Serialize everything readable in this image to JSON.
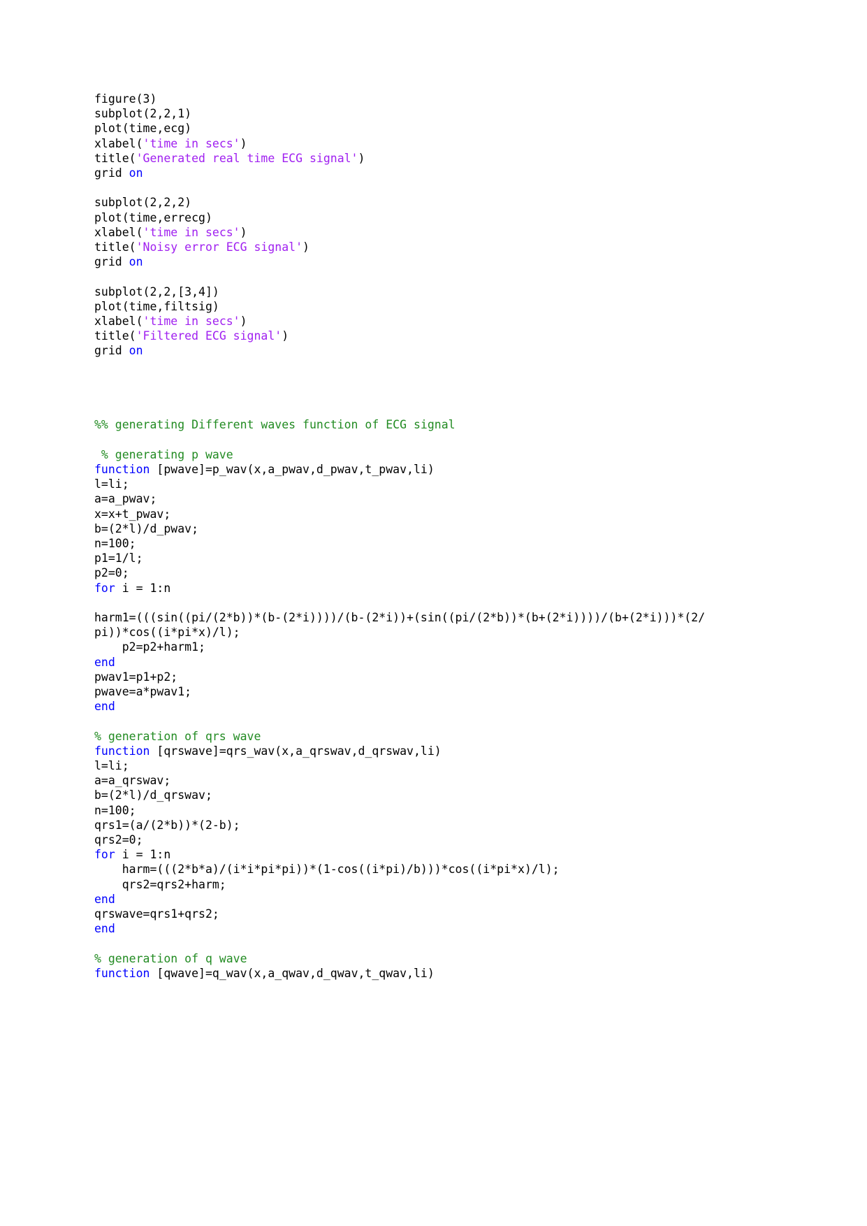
{
  "document": {
    "kind": "source-code-listing",
    "language": "MATLAB",
    "page_background": "#ffffff",
    "colors": {
      "plain": "#000000",
      "string": "#a020f0",
      "comment": "#228b22",
      "keyword": "#0000ff"
    }
  },
  "code": {
    "lines": [
      {
        "id": "l1",
        "type": "code",
        "tokens": [
          {
            "t": "figure(3)",
            "c": "plain"
          }
        ]
      },
      {
        "id": "l2",
        "type": "code",
        "tokens": [
          {
            "t": "subplot(2,2,1)",
            "c": "plain"
          }
        ]
      },
      {
        "id": "l3",
        "type": "code",
        "tokens": [
          {
            "t": "plot(time,ecg)",
            "c": "plain"
          }
        ]
      },
      {
        "id": "l4",
        "type": "code",
        "tokens": [
          {
            "t": "xlabel(",
            "c": "plain"
          },
          {
            "t": "'time in secs'",
            "c": "string"
          },
          {
            "t": ")",
            "c": "plain"
          }
        ]
      },
      {
        "id": "l5",
        "type": "code",
        "tokens": [
          {
            "t": "title(",
            "c": "plain"
          },
          {
            "t": "'Generated real time ECG signal'",
            "c": "string"
          },
          {
            "t": ")",
            "c": "plain"
          }
        ]
      },
      {
        "id": "l6",
        "type": "code",
        "tokens": [
          {
            "t": "grid ",
            "c": "plain"
          },
          {
            "t": "on",
            "c": "keyword"
          }
        ]
      },
      {
        "id": "l7",
        "type": "blank",
        "tokens": []
      },
      {
        "id": "l8",
        "type": "code",
        "tokens": [
          {
            "t": "subplot(2,2,2)",
            "c": "plain"
          }
        ]
      },
      {
        "id": "l9",
        "type": "code",
        "tokens": [
          {
            "t": "plot(time,errecg)",
            "c": "plain"
          }
        ]
      },
      {
        "id": "l10",
        "type": "code",
        "tokens": [
          {
            "t": "xlabel(",
            "c": "plain"
          },
          {
            "t": "'time in secs'",
            "c": "string"
          },
          {
            "t": ")",
            "c": "plain"
          }
        ]
      },
      {
        "id": "l11",
        "type": "code",
        "tokens": [
          {
            "t": "title(",
            "c": "plain"
          },
          {
            "t": "'Noisy error ECG signal'",
            "c": "string"
          },
          {
            "t": ")",
            "c": "plain"
          }
        ]
      },
      {
        "id": "l12",
        "type": "code",
        "tokens": [
          {
            "t": "grid ",
            "c": "plain"
          },
          {
            "t": "on",
            "c": "keyword"
          }
        ]
      },
      {
        "id": "l13",
        "type": "blank",
        "tokens": []
      },
      {
        "id": "l14",
        "type": "code",
        "tokens": [
          {
            "t": "subplot(2,2,[3,4])",
            "c": "plain"
          }
        ]
      },
      {
        "id": "l15",
        "type": "code",
        "tokens": [
          {
            "t": "plot(time,filtsig)",
            "c": "plain"
          }
        ]
      },
      {
        "id": "l16",
        "type": "code",
        "tokens": [
          {
            "t": "xlabel(",
            "c": "plain"
          },
          {
            "t": "'time in secs'",
            "c": "string"
          },
          {
            "t": ")",
            "c": "plain"
          }
        ]
      },
      {
        "id": "l17",
        "type": "code",
        "tokens": [
          {
            "t": "title(",
            "c": "plain"
          },
          {
            "t": "'Filtered ECG signal'",
            "c": "string"
          },
          {
            "t": ")",
            "c": "plain"
          }
        ]
      },
      {
        "id": "l18",
        "type": "code",
        "tokens": [
          {
            "t": "grid ",
            "c": "plain"
          },
          {
            "t": "on",
            "c": "keyword"
          }
        ]
      },
      {
        "id": "l19",
        "type": "blank",
        "tokens": []
      },
      {
        "id": "l20",
        "type": "blank",
        "tokens": []
      },
      {
        "id": "l21",
        "type": "blank",
        "tokens": []
      },
      {
        "id": "l22",
        "type": "blank",
        "tokens": []
      },
      {
        "id": "l23",
        "type": "code",
        "tokens": [
          {
            "t": "%% generating Different waves function of ECG signal",
            "c": "comment"
          }
        ]
      },
      {
        "id": "l24",
        "type": "blank",
        "tokens": []
      },
      {
        "id": "l25",
        "type": "code",
        "tokens": [
          {
            "t": " % generating p wave",
            "c": "comment"
          }
        ]
      },
      {
        "id": "l26",
        "type": "code",
        "tokens": [
          {
            "t": "function",
            "c": "keyword"
          },
          {
            "t": " [pwave]=p_wav(x,a_pwav,d_pwav,t_pwav,li)",
            "c": "plain"
          }
        ]
      },
      {
        "id": "l27",
        "type": "code",
        "tokens": [
          {
            "t": "l=li;",
            "c": "plain"
          }
        ]
      },
      {
        "id": "l28",
        "type": "code",
        "tokens": [
          {
            "t": "a=a_pwav;",
            "c": "plain"
          }
        ]
      },
      {
        "id": "l29",
        "type": "code",
        "tokens": [
          {
            "t": "x=x+t_pwav;",
            "c": "plain"
          }
        ]
      },
      {
        "id": "l30",
        "type": "code",
        "tokens": [
          {
            "t": "b=(2*l)/d_pwav;",
            "c": "plain"
          }
        ]
      },
      {
        "id": "l31",
        "type": "code",
        "tokens": [
          {
            "t": "n=100;",
            "c": "plain"
          }
        ]
      },
      {
        "id": "l32",
        "type": "code",
        "tokens": [
          {
            "t": "p1=1/l;",
            "c": "plain"
          }
        ]
      },
      {
        "id": "l33",
        "type": "code",
        "tokens": [
          {
            "t": "p2=0;",
            "c": "plain"
          }
        ]
      },
      {
        "id": "l34",
        "type": "code",
        "tokens": [
          {
            "t": "for",
            "c": "keyword"
          },
          {
            "t": " i = 1:n",
            "c": "plain"
          }
        ]
      },
      {
        "id": "l35",
        "type": "blank",
        "tokens": []
      },
      {
        "id": "l36",
        "type": "wrap",
        "tokens": [
          {
            "t": "harm1=(((sin((pi/(2*b))*(b-(2*i))))/(b-(2*i))+(sin((pi/(2*b))*(b+(2*i))))/(b+(2*i)))*(2/pi))*cos((i*pi*x)/l);",
            "c": "plain"
          }
        ]
      },
      {
        "id": "l37",
        "type": "code",
        "tokens": [
          {
            "t": "    p2=p2+harm1;",
            "c": "plain"
          }
        ]
      },
      {
        "id": "l38",
        "type": "code",
        "tokens": [
          {
            "t": "end",
            "c": "keyword"
          }
        ]
      },
      {
        "id": "l39",
        "type": "code",
        "tokens": [
          {
            "t": "pwav1=p1+p2;",
            "c": "plain"
          }
        ]
      },
      {
        "id": "l40",
        "type": "code",
        "tokens": [
          {
            "t": "pwave=a*pwav1;",
            "c": "plain"
          }
        ]
      },
      {
        "id": "l41",
        "type": "code",
        "tokens": [
          {
            "t": "end",
            "c": "keyword"
          }
        ]
      },
      {
        "id": "l42",
        "type": "blank",
        "tokens": []
      },
      {
        "id": "l43",
        "type": "code",
        "tokens": [
          {
            "t": "% generation of qrs wave",
            "c": "comment"
          }
        ]
      },
      {
        "id": "l44",
        "type": "code",
        "tokens": [
          {
            "t": "function",
            "c": "keyword"
          },
          {
            "t": " [qrswave]=qrs_wav(x,a_qrswav,d_qrswav,li)",
            "c": "plain"
          }
        ]
      },
      {
        "id": "l45",
        "type": "code",
        "tokens": [
          {
            "t": "l=li;",
            "c": "plain"
          }
        ]
      },
      {
        "id": "l46",
        "type": "code",
        "tokens": [
          {
            "t": "a=a_qrswav;",
            "c": "plain"
          }
        ]
      },
      {
        "id": "l47",
        "type": "code",
        "tokens": [
          {
            "t": "b=(2*l)/d_qrswav;",
            "c": "plain"
          }
        ]
      },
      {
        "id": "l48",
        "type": "code",
        "tokens": [
          {
            "t": "n=100;",
            "c": "plain"
          }
        ]
      },
      {
        "id": "l49",
        "type": "code",
        "tokens": [
          {
            "t": "qrs1=(a/(2*b))*(2-b);",
            "c": "plain"
          }
        ]
      },
      {
        "id": "l50",
        "type": "code",
        "tokens": [
          {
            "t": "qrs2=0;",
            "c": "plain"
          }
        ]
      },
      {
        "id": "l51",
        "type": "code",
        "tokens": [
          {
            "t": "for",
            "c": "keyword"
          },
          {
            "t": " i = 1:n",
            "c": "plain"
          }
        ]
      },
      {
        "id": "l52",
        "type": "code",
        "tokens": [
          {
            "t": "    harm=(((2*b*a)/(i*i*pi*pi))*(1-cos((i*pi)/b)))*cos((i*pi*x)/l);",
            "c": "plain"
          }
        ]
      },
      {
        "id": "l53",
        "type": "code",
        "tokens": [
          {
            "t": "    qrs2=qrs2+harm;",
            "c": "plain"
          }
        ]
      },
      {
        "id": "l54",
        "type": "code",
        "tokens": [
          {
            "t": "end",
            "c": "keyword"
          }
        ]
      },
      {
        "id": "l55",
        "type": "code",
        "tokens": [
          {
            "t": "qrswave=qrs1+qrs2;",
            "c": "plain"
          }
        ]
      },
      {
        "id": "l56",
        "type": "code",
        "tokens": [
          {
            "t": "end",
            "c": "keyword"
          }
        ]
      },
      {
        "id": "l57",
        "type": "blank",
        "tokens": []
      },
      {
        "id": "l58",
        "type": "code",
        "tokens": [
          {
            "t": "% generation of q wave",
            "c": "comment"
          }
        ]
      },
      {
        "id": "l59",
        "type": "code",
        "tokens": [
          {
            "t": "function",
            "c": "keyword"
          },
          {
            "t": " [qwave]=q_wav(x,a_qwav,d_qwav,t_qwav,li)",
            "c": "plain"
          }
        ]
      }
    ]
  }
}
